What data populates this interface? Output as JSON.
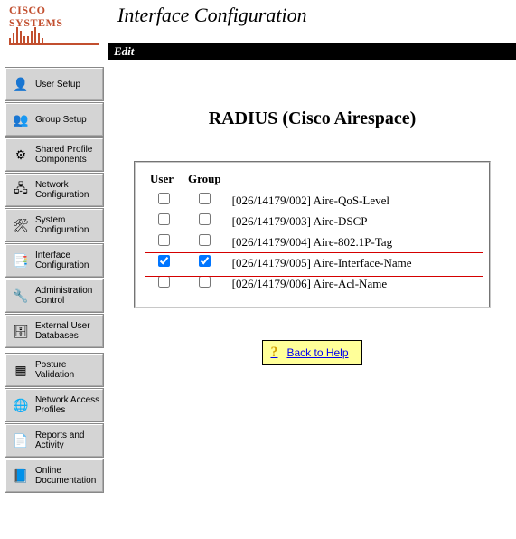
{
  "logo_text": "CISCO SYSTEMS",
  "page_title": "Interface Configuration",
  "menu_bar": "Edit",
  "sidebar": {
    "items": [
      {
        "label": "User\nSetup",
        "icon": "👤"
      },
      {
        "label": "Group\nSetup",
        "icon": "👥"
      },
      {
        "label": "Shared Profile\nComponents",
        "icon": "⚙"
      },
      {
        "label": "Network\nConfiguration",
        "icon": "🖧"
      },
      {
        "label": "System\nConfiguration",
        "icon": "🛠"
      },
      {
        "label": "Interface\nConfiguration",
        "icon": "📑"
      },
      {
        "label": "Administration\nControl",
        "icon": "🔧"
      },
      {
        "label": "External User\nDatabases",
        "icon": "🗄"
      },
      {
        "label": "Posture\nValidation",
        "icon": "▦"
      },
      {
        "label": "Network Access\nProfiles",
        "icon": "🌐"
      },
      {
        "label": "Reports and\nActivity",
        "icon": "📄"
      },
      {
        "label": "Online\nDocumentation",
        "icon": "📘"
      }
    ],
    "dividers_after": [
      7
    ]
  },
  "main": {
    "heading": "RADIUS (Cisco Airespace)",
    "columns": {
      "user": "User",
      "group": "Group"
    },
    "rows": [
      {
        "user": false,
        "group": false,
        "label": "[026/14179/002] Aire-QoS-Level",
        "hl": false
      },
      {
        "user": false,
        "group": false,
        "label": "[026/14179/003] Aire-DSCP",
        "hl": false
      },
      {
        "user": false,
        "group": false,
        "label": "[026/14179/004] Aire-802.1P-Tag",
        "hl": false
      },
      {
        "user": true,
        "group": true,
        "label": "[026/14179/005] Aire-Interface-Name",
        "hl": true
      },
      {
        "user": false,
        "group": false,
        "label": "[026/14179/006] Aire-Acl-Name",
        "hl": false
      }
    ],
    "help_label": "Back to Help"
  }
}
